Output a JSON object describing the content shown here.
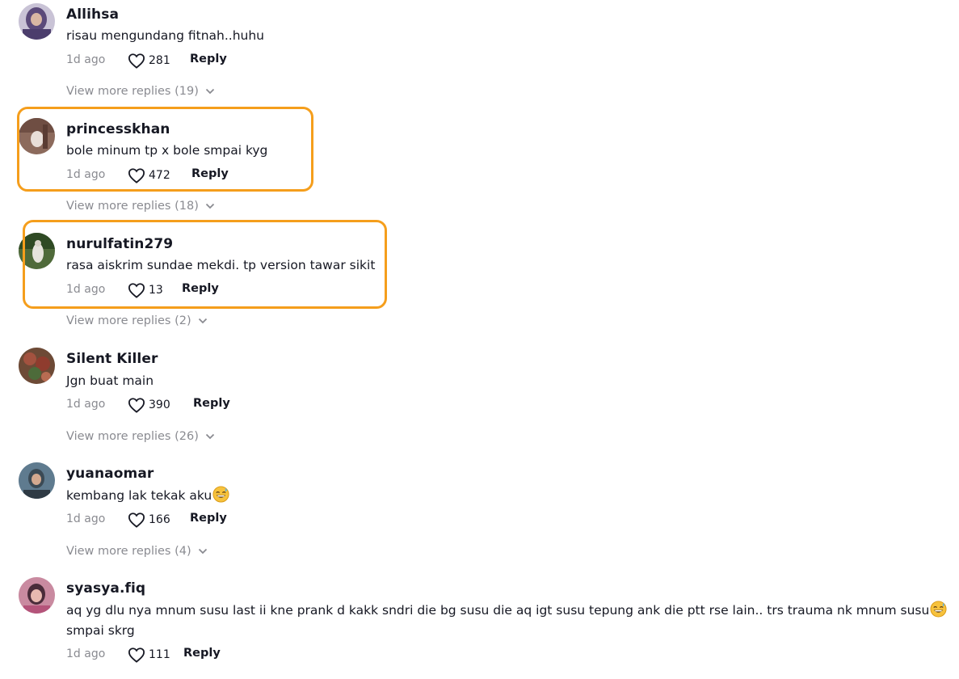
{
  "colors": {
    "highlight": "#f59e1c",
    "muted": "#8a8b91",
    "text": "#161823"
  },
  "comments": [
    {
      "username": "Allihsa",
      "text": "risau mengundang fitnah..huhu",
      "time": "1d ago",
      "likes": "281",
      "reply": "Reply",
      "view_more": "View more replies (19)"
    },
    {
      "username": "princesskhan",
      "text": "bole minum tp x bole smpai kyg",
      "time": "1d ago",
      "likes": "472",
      "reply": "Reply",
      "view_more": "View more replies (18)",
      "highlighted": true
    },
    {
      "username": "nurulfatin279",
      "text": "rasa aiskrim sundae mekdi. tp version tawar sikit",
      "time": "1d ago",
      "likes": "13",
      "reply": "Reply",
      "view_more": "View more replies (2)",
      "highlighted": true
    },
    {
      "username": "Silent Killer",
      "text": "Jgn buat main",
      "time": "1d ago",
      "likes": "390",
      "reply": "Reply",
      "view_more": "View more replies (26)"
    },
    {
      "username": "yuanaomar",
      "text": "kembang lak tekak aku",
      "emoji": "grinning-sweat-emoji",
      "time": "1d ago",
      "likes": "166",
      "reply": "Reply",
      "view_more": "View more replies (4)"
    },
    {
      "username": "syasya.fiq",
      "text_line1": "aq yg dlu nya mnum susu last ii kne prank d kakk sndri die bg susu die aq igt susu tepung ank die ptt rse lain.. trs trauma nk mnum susu",
      "text_line2": "smpai skrg",
      "emoji": "grinning-sweat-emoji",
      "time": "1d ago",
      "likes": "111",
      "reply": "Reply"
    }
  ],
  "icons": {
    "like": "heart-outline-icon",
    "expand": "chevron-down-icon"
  }
}
